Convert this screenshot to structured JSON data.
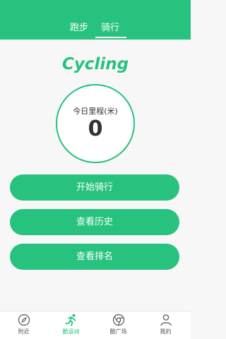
{
  "header": {
    "tabs": [
      {
        "label": "跑步"
      },
      {
        "label": "骑行"
      }
    ],
    "active_tab": 1
  },
  "main": {
    "title": "Cycling",
    "stat": {
      "label": "今日里程(米)",
      "value": "0"
    },
    "buttons": {
      "start": "开始骑行",
      "history": "查看历史",
      "rank": "查看排名"
    }
  },
  "footer": {
    "items": [
      {
        "label": "附近",
        "icon": "compass-icon"
      },
      {
        "label": "酷运动",
        "icon": "runner-icon"
      },
      {
        "label": "酷广场",
        "icon": "chrome-icon"
      },
      {
        "label": "我的",
        "icon": "user-icon"
      }
    ],
    "active_index": 1
  },
  "colors": {
    "accent": "#27c27e",
    "background": "#f7f7f7",
    "text": "#333333"
  }
}
